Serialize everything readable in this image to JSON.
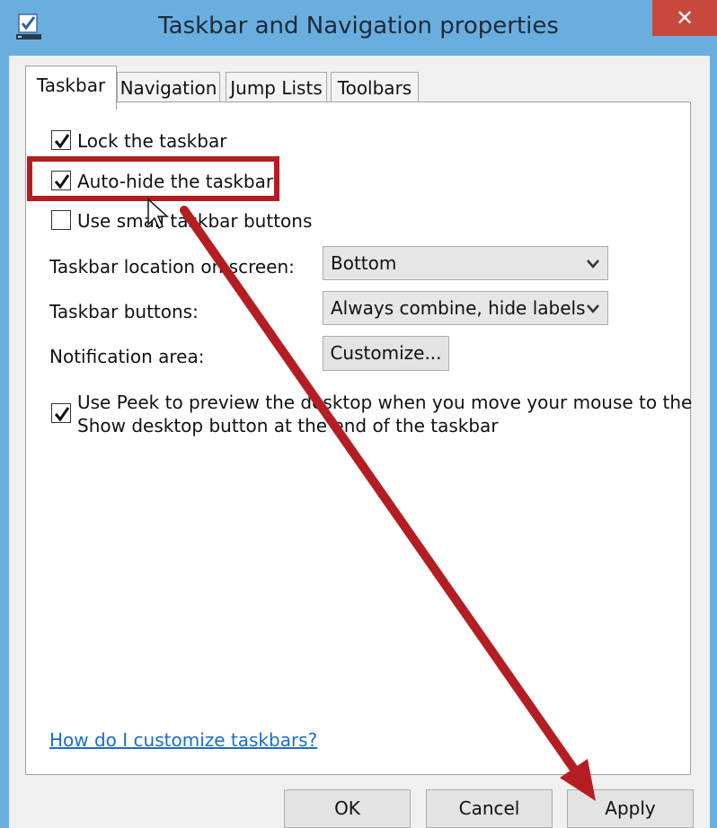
{
  "window": {
    "title": "Taskbar and Navigation properties",
    "close_label": "✕"
  },
  "tabs": [
    {
      "label": "Taskbar",
      "active": true
    },
    {
      "label": "Navigation",
      "active": false
    },
    {
      "label": "Jump Lists",
      "active": false
    },
    {
      "label": "Toolbars",
      "active": false
    }
  ],
  "taskbar": {
    "lock": {
      "label": "Lock the taskbar",
      "checked": true
    },
    "autohide": {
      "label": "Auto-hide the taskbar",
      "checked": true
    },
    "small_buttons": {
      "label": "Use small taskbar buttons",
      "checked": false
    },
    "location": {
      "label": "Taskbar location on screen:",
      "value": "Bottom"
    },
    "buttons": {
      "label": "Taskbar buttons:",
      "value": "Always combine, hide labels"
    },
    "notification": {
      "label": "Notification area:",
      "button": "Customize..."
    },
    "peek": {
      "line1": "Use Peek to preview the desktop when you move your mouse to the",
      "line2": "Show desktop button at the end of the taskbar",
      "checked": true
    },
    "help_link": "How do I customize taskbars?"
  },
  "footer": {
    "ok": "OK",
    "cancel": "Cancel",
    "apply": "Apply"
  },
  "colors": {
    "frame": "#6aaedf",
    "close": "#c7493c",
    "annotation": "#b41e22",
    "link": "#1a6dc9"
  }
}
